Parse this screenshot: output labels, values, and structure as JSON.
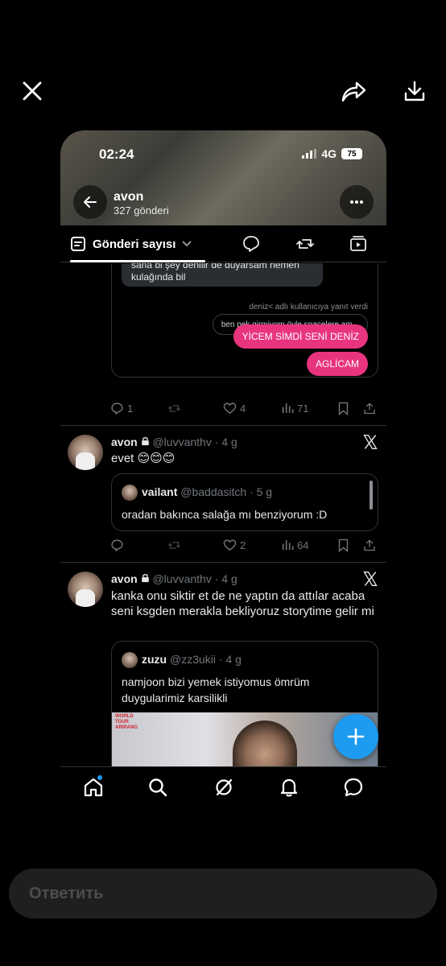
{
  "viewer": {
    "close_icon": "close-icon",
    "share_icon": "share-icon",
    "download_icon": "download-icon"
  },
  "status_bar": {
    "time": "02:24",
    "network": "4G",
    "battery": "75"
  },
  "profile": {
    "name": "avon",
    "post_count": "327 gönderi"
  },
  "tabs": {
    "active_label": "Gönderi sayısı"
  },
  "dm_post": {
    "received_text": "sana bi şey denilir de duyarsam nemen kulağında bil",
    "reply_note": "deniz< adlı kullanıcıya yanıt verdi",
    "quoted_reply": "ben pek girmiyom öyle spacelere am...",
    "message_1": "YİCEM SİMDİ SENİ DENİZ",
    "message_2": "AGLİCAM",
    "replies": "1",
    "likes": "4",
    "views": "71"
  },
  "post_2": {
    "author": "avon",
    "handle": "@luvvanthv · 4 g",
    "text": "evet 😊😊😊",
    "quote": {
      "author": "vailant",
      "handle": "@baddasitch · 5 g",
      "text": "oradan bakınca salağa mı benziyorum :D"
    },
    "likes": "2",
    "views": "64"
  },
  "post_3": {
    "author": "avon",
    "handle": "@luvvanthv · 4 g",
    "text": "kanka onu siktir et de ne yaptın da attılar acaba seni ksgden merakla bekliyoruz storytime gelir mi",
    "quote": {
      "author": "zuzu",
      "handle": "@zz3ukii · 4 g",
      "text": "namjoon bizi yemek istiyomus ömrüm duygularimiz karsilikli",
      "media_tag": "WORLD TOUR ARIRANG"
    }
  },
  "reply_bar": {
    "placeholder": "Ответить"
  },
  "colors": {
    "accent": "#1d9bf0",
    "pink_bubble": "#e8347f",
    "background": "#000000"
  }
}
